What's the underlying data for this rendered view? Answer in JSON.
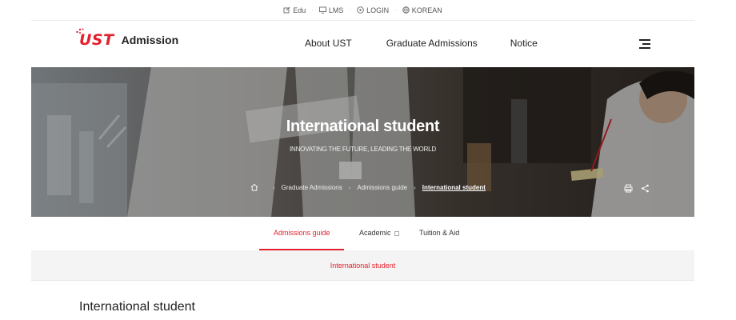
{
  "util": {
    "items": [
      {
        "label": "Edu",
        "icon": "edu-icon"
      },
      {
        "label": "LMS",
        "icon": "monitor-icon"
      },
      {
        "label": "LOGIN",
        "icon": "lock-icon"
      },
      {
        "label": "KOREAN",
        "icon": "globe-icon"
      }
    ]
  },
  "header": {
    "logo_text": "UST",
    "logo_title": "Admission",
    "nav": [
      "About UST",
      "Graduate Admissions",
      "Notice"
    ]
  },
  "hero": {
    "title": "International student",
    "subtitle": "INNOVATING THE FUTURE, LEADING THE WORLD",
    "breadcrumbs": [
      "Graduate Admissions",
      "Admissions guide",
      "International student"
    ]
  },
  "tabs": [
    {
      "label": "Admissions guide",
      "active": true
    },
    {
      "label": "Academic",
      "active": false
    },
    {
      "label": "Tuition & Aid",
      "active": false
    }
  ],
  "subband": {
    "label": "International student"
  },
  "page": {
    "title": "International student"
  },
  "colors": {
    "accent": "#e4202c"
  }
}
